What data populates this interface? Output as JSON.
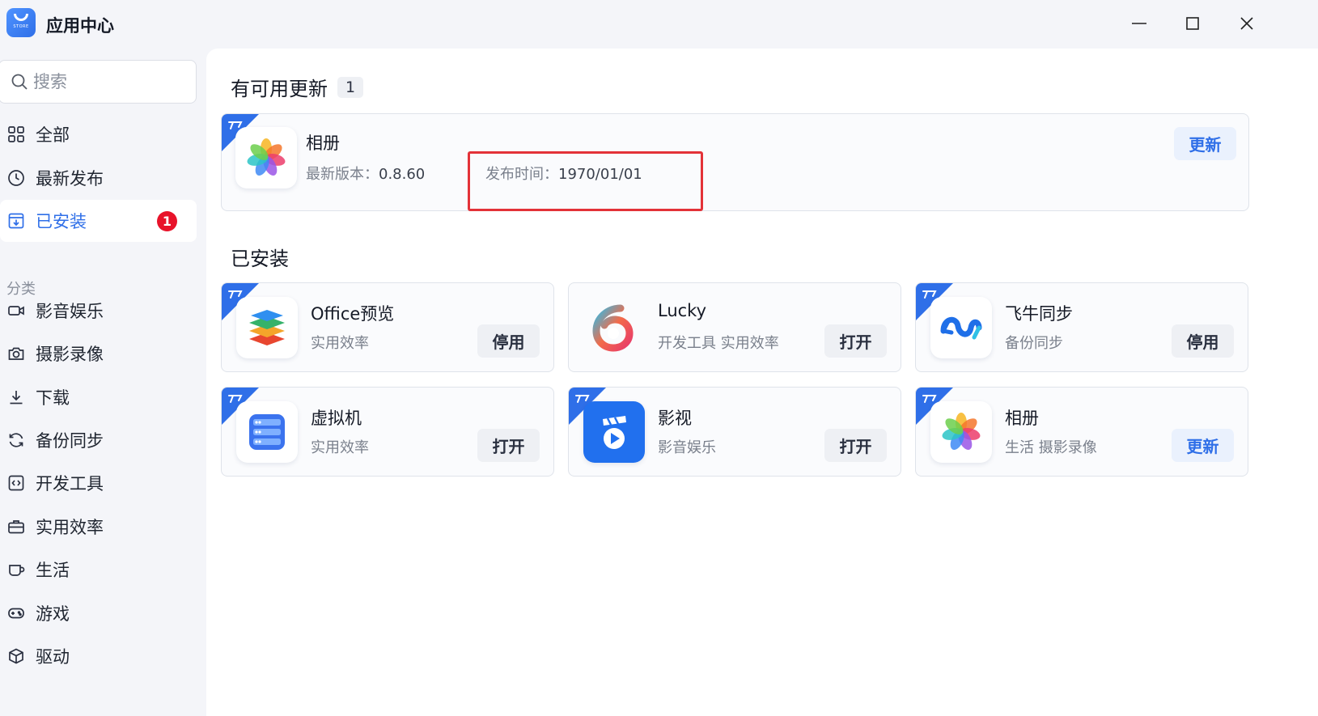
{
  "window": {
    "title": "应用中心",
    "logo_text": "STORE",
    "controls": [
      "minimize-icon",
      "maximize-icon",
      "close-icon"
    ]
  },
  "sidebar": {
    "search_placeholder": "搜索",
    "items": [
      {
        "label": "全部",
        "icon": "grid-icon"
      },
      {
        "label": "最新发布",
        "icon": "clock-icon"
      },
      {
        "label": "已安装",
        "icon": "installed-box-icon",
        "active": true,
        "badge": "1"
      }
    ],
    "category_title": "分类",
    "categories": [
      {
        "label": "影音娱乐",
        "icon": "video-camera-icon"
      },
      {
        "label": "摄影录像",
        "icon": "camera-icon"
      },
      {
        "label": "下载",
        "icon": "download-icon"
      },
      {
        "label": "备份同步",
        "icon": "sync-icon"
      },
      {
        "label": "开发工具",
        "icon": "code-icon"
      },
      {
        "label": "实用效率",
        "icon": "briefcase-icon"
      },
      {
        "label": "生活",
        "icon": "cup-icon"
      },
      {
        "label": "游戏",
        "icon": "gamepad-icon"
      },
      {
        "label": "驱动",
        "icon": "cube-icon"
      }
    ]
  },
  "updates": {
    "title": "有可用更新",
    "count": "1",
    "item": {
      "name": "相册",
      "version_label": "最新版本：",
      "version": "0.8.60",
      "release_label": "发布时间：",
      "release_date": "1970/01/01",
      "action": "更新"
    }
  },
  "installed": {
    "title": "已安装",
    "apps": [
      {
        "name": "Office预览",
        "tags": "实用效率",
        "action": "停用",
        "icon": "office-layers-icon"
      },
      {
        "name": "Lucky",
        "tags": "开发工具 实用效率",
        "action": "打开",
        "icon": "lucky-six-icon"
      },
      {
        "name": "飞牛同步",
        "tags": "备份同步",
        "action": "停用",
        "icon": "fnsync-wave-icon"
      },
      {
        "name": "虚拟机",
        "tags": "实用效率",
        "action": "打开",
        "icon": "server-rack-icon"
      },
      {
        "name": "影视",
        "tags": "影音娱乐",
        "action": "打开",
        "icon": "clapper-play-icon"
      },
      {
        "name": "相册",
        "tags": "生活 摄影录像",
        "action": "更新",
        "icon": "photo-flower-icon"
      }
    ]
  },
  "colors": {
    "accent": "#2f6fe8",
    "badge": "#e8132a",
    "highlight": "#e33238"
  }
}
